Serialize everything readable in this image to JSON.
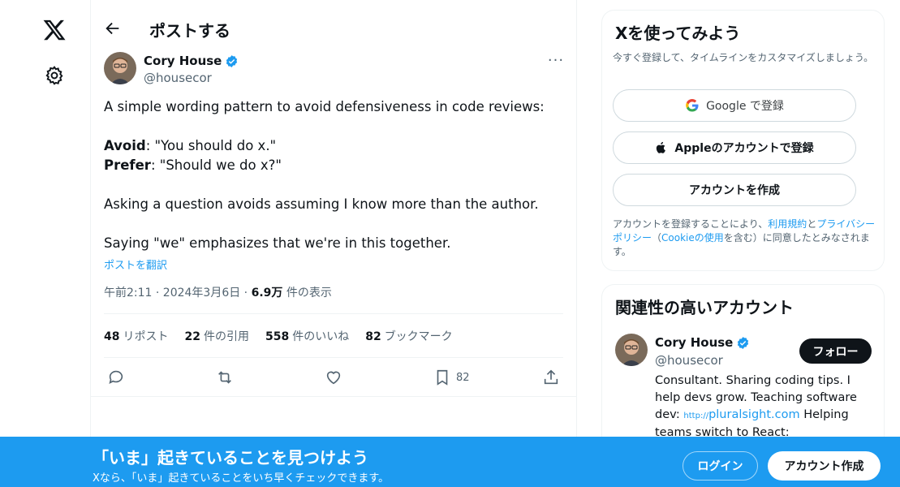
{
  "nav": {
    "logo_icon": "x-logo-icon",
    "settings_icon": "gear-icon"
  },
  "header": {
    "title": "ポストする",
    "back_icon": "back-arrow-icon"
  },
  "post": {
    "author_name": "Cory House",
    "author_handle": "@housecor",
    "lines": {
      "intro": "A simple wording pattern to avoid defensiveness in code reviews:",
      "avoid_label": "Avoid",
      "avoid_text": ": \"You should do x.\"",
      "prefer_label": "Prefer",
      "prefer_text": ": \"Should we do x?\"",
      "question": "Asking a question avoids assuming I know more than the author.",
      "we": "Saying \"we\" emphasizes that we're in this together."
    },
    "translate_label": "ポストを翻訳",
    "timestamp": "午前2:11 · 2024年3月6日 · ",
    "views_count": "6.9万",
    "views_label": " 件の表示",
    "stats": {
      "reposts_count": "48",
      "reposts_label": "リポスト",
      "quotes_count": "22",
      "quotes_label": "件の引用",
      "likes_count": "558",
      "likes_label": "件のいいね",
      "bookmarks_count": "82",
      "bookmarks_label": "ブックマーク"
    },
    "actions": {
      "bookmark_count": "82"
    }
  },
  "signup": {
    "title": "Xを使ってみよう",
    "subtitle": "今すぐ登録して、タイムラインをカスタマイズしましょう。",
    "google_label": "Google で登録",
    "apple_label": "Appleのアカウントで登録",
    "create_label": "アカウントを作成",
    "legal_1": "アカウントを登録することにより、",
    "legal_terms": "利用規約",
    "legal_2": "と",
    "legal_privacy": "プライバシーポリシー",
    "legal_3": "（",
    "legal_cookie": "Cookieの使用",
    "legal_4": "を含む）に同意したとみなされます。"
  },
  "related": {
    "title": "関連性の高いアカウント",
    "name": "Cory House",
    "handle": "@housecor",
    "follow_label": "フォロー",
    "bio_1": "Consultant. Sharing coding tips. I help devs grow. Teaching software dev: ",
    "bio_http": "http://",
    "bio_url": "pluralsight.com",
    "bio_2": " Helping teams switch to React:"
  },
  "banner": {
    "title": "「いま」起きていることを見つけよう",
    "subtitle": "Xなら、「いま」起きていることをいち早くチェックできます。",
    "login_label": "ログイン",
    "signup_label": "アカウント作成"
  },
  "colors": {
    "accent": "#1d9bf0",
    "text": "#0f1419",
    "muted": "#536471",
    "border": "#eff3f4"
  }
}
